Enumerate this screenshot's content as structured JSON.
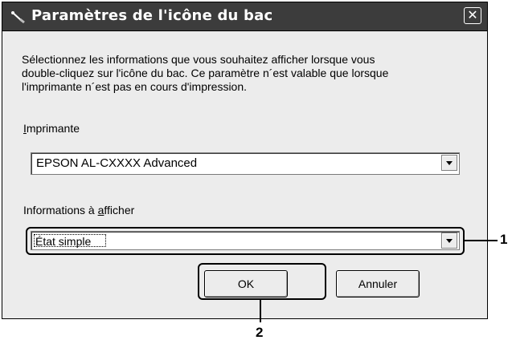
{
  "dialog": {
    "title": "Paramètres de l'icône du bac",
    "close_symbol": "✕",
    "description": "Sélectionnez les informations que vous souhaitez afficher lorsque vous\ndouble-cliquez sur l'icône du bac. Ce paramètre n´est valable que lorsque\nl'imprimante n´est pas en cours d'impression.",
    "printer_label_accel": "I",
    "printer_label_rest": "mprimante",
    "printer_value": "EPSON AL-CXXXX Advanced",
    "info_label_pre": "Informations à ",
    "info_label_accel": "a",
    "info_label_post": "fficher",
    "info_value": "État simple",
    "ok_label": "OK",
    "cancel_label": "Annuler"
  },
  "callouts": {
    "one": "1",
    "two": "2"
  },
  "icons": {
    "title": "printer-tray-icon",
    "dropdown": "chevron-down-icon"
  }
}
